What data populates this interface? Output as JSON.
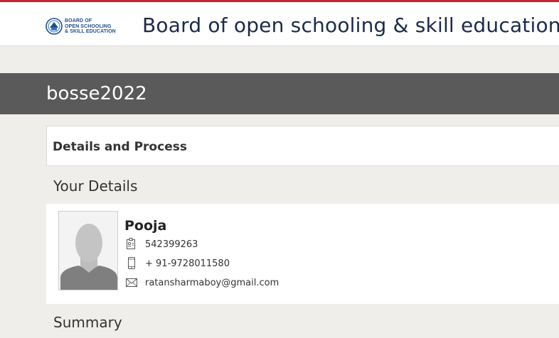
{
  "header": {
    "logo_text_lines": [
      "BOARD OF",
      "OPEN SCHOOLING",
      "& SKILL EDUCATION"
    ],
    "site_title": "Board of open schooling & skill education"
  },
  "page": {
    "title": "bosse2022"
  },
  "details_panel": {
    "title": "Details and Process"
  },
  "your_details": {
    "heading": "Your Details",
    "name": "Pooja",
    "id_number": "542399263",
    "phone": "+ 91-9728011580",
    "email": "ratansharmaboy@gmail.com",
    "icons": [
      "id-card-icon",
      "mobile-phone-icon",
      "envelope-icon"
    ]
  },
  "summary": {
    "heading": "Summary"
  },
  "colors": {
    "accent": "#c1272d",
    "title_bar": "#5a5a5a",
    "background": "#efeeeb",
    "logo_blue": "#1f4f8c"
  }
}
